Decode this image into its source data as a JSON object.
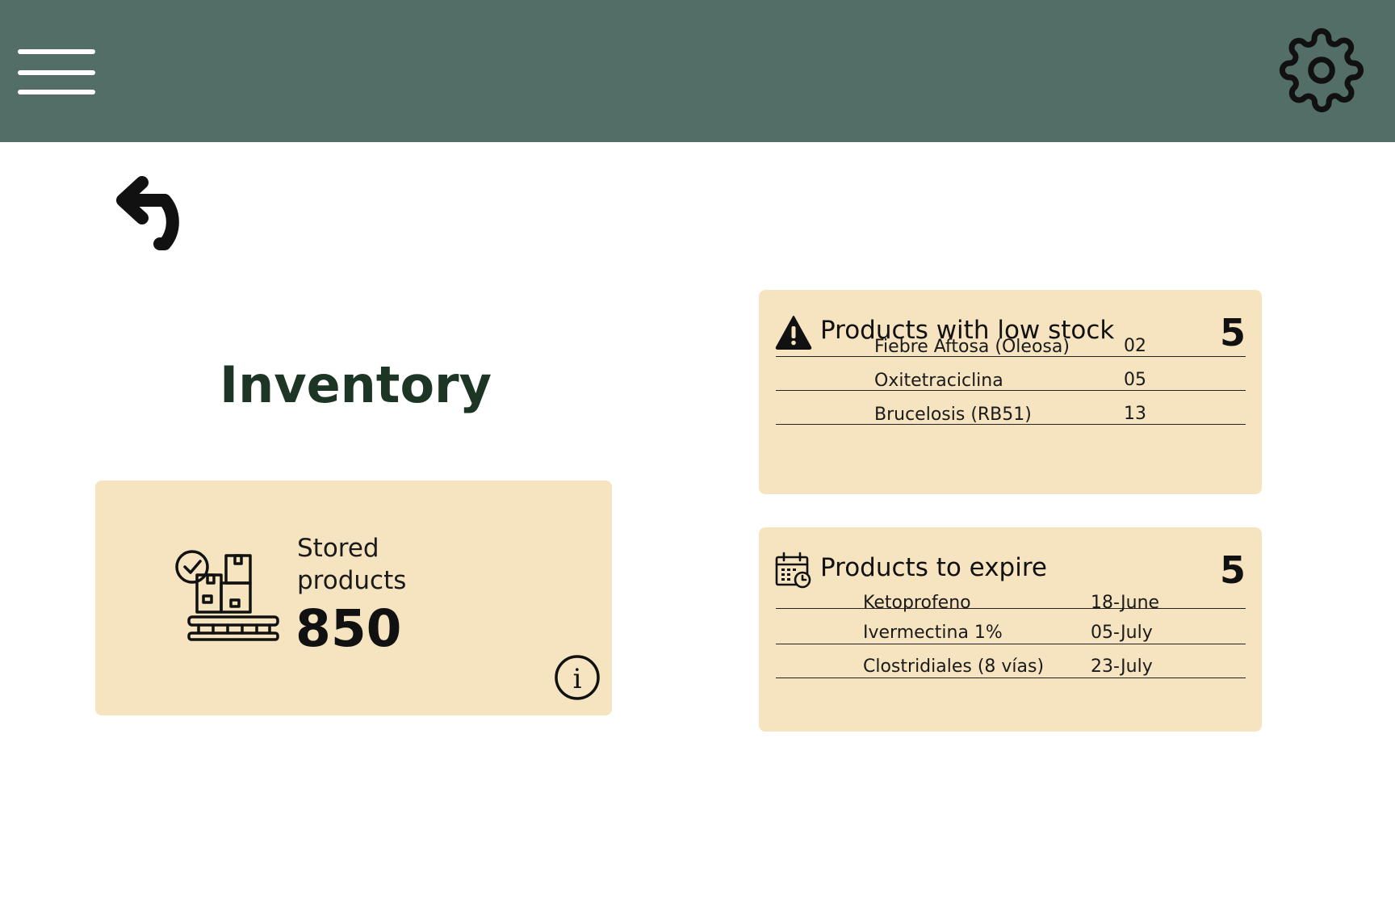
{
  "header": {
    "menu_icon": "hamburger-menu-icon",
    "settings_icon": "gear-icon",
    "background_color": "#526e66"
  },
  "navigation": {
    "back_icon": "undo-arrow-icon"
  },
  "page": {
    "title": "Inventory",
    "title_color": "#1d3524"
  },
  "stored_products": {
    "label_line1": "Stored",
    "label_line2": "products",
    "value": "850",
    "icon": "pallet-boxes-check-icon",
    "info_icon": "info-icon"
  },
  "low_stock": {
    "icon": "warning-icon",
    "title": "Products with low stock",
    "count": "5",
    "items": [
      {
        "name": "Fiebre Aftosa (Oleosa)",
        "quantity": "02"
      },
      {
        "name": "Oxitetraciclina",
        "quantity": "05"
      },
      {
        "name": "Brucelosis (RB51)",
        "quantity": "13"
      }
    ]
  },
  "expiring": {
    "icon": "calendar-clock-icon",
    "title": "Products to expire",
    "count": "5",
    "items": [
      {
        "name": "Ketoprofeno",
        "date": "18-June",
        "struck": true
      },
      {
        "name": "Ivermectina 1%",
        "date": "05-July",
        "struck": false
      },
      {
        "name": "Clostridiales (8 vías)",
        "date": "23-July",
        "struck": false
      }
    ]
  },
  "theme": {
    "card_color": "#f5e4bf"
  }
}
